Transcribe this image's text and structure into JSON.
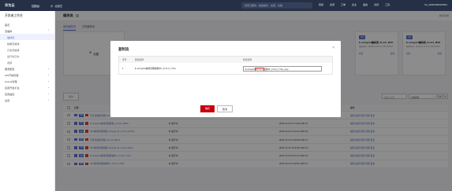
{
  "topbar": {
    "brand": "华为云",
    "console": "控制台",
    "region": "北京四",
    "search_placeholder": "搜索云服务、快捷操作、资源、文档",
    "links": [
      "费用",
      "资源",
      "工单",
      "企业",
      "备案",
      "支持",
      "工具"
    ],
    "user": "hw_00001000010001"
  },
  "sidebar": {
    "title": "开发者工作台",
    "items": [
      {
        "label": "首页",
        "active": false,
        "sub": false
      },
      {
        "label": "流编排",
        "active": false,
        "sub": false,
        "arrow": "⌃"
      },
      {
        "label": "编排流",
        "active": true,
        "sub": true
      },
      {
        "label": "数据流编排",
        "active": false,
        "sub": true
      },
      {
        "label": "日志流编排",
        "active": false,
        "sub": true
      },
      {
        "label": "运行时日志",
        "active": false,
        "sub": true
      },
      {
        "label": "连接",
        "active": false,
        "sub": true
      },
      {
        "label": "服务配置",
        "active": false,
        "sub": false,
        "arrow": "⌄"
      },
      {
        "label": "API开放管理",
        "active": false,
        "sub": false,
        "arrow": "⌄"
      },
      {
        "label": "Assets管理",
        "active": false,
        "sub": false,
        "arrow": "⌄"
      },
      {
        "label": "应用开发平台",
        "active": false,
        "sub": false,
        "arrow": "⌄"
      },
      {
        "label": "应用监控",
        "active": false,
        "sub": false,
        "arrow": "⌄"
      },
      {
        "label": "设置",
        "active": false,
        "sub": false,
        "arrow": "⌄"
      }
    ]
  },
  "page": {
    "title": "编排流",
    "help": "?",
    "right_link": "新手引导",
    "tabs": [
      {
        "label": "我的编排流",
        "active": true
      },
      {
        "label": "共享编排流",
        "active": false
      }
    ]
  },
  "cards": {
    "create_label": "创建",
    "flows": [
      {
        "tag": "API",
        "name": "E-octogrd4编排流_21-9-0_8F/D",
        "meta": "更新时间：2023-10-16 17:11:25 GMT+8",
        "op1": "启用",
        "op2": "复制"
      },
      {
        "tag": "API",
        "name": "E-octogrd4编排流_21-9-0_8F/D",
        "meta": "更新时间：2023-10-16 17:11:25 GMT+8",
        "op1": "启用",
        "op2": "复制"
      }
    ]
  },
  "toolbar": {
    "batch_label": "删除",
    "filter_placeholder": "请输入名称",
    "search_label": "名称搜索",
    "search_icon": "⌕",
    "settings_icon": "⚙",
    "refresh_icon": "↻"
  },
  "table": {
    "headers": [
      "名称",
      "状态",
      "描述",
      "创建时间",
      "操作"
    ],
    "rows": [
      {
        "name": "日志流编排流程-Octogrd_M_21-9-0_testX_3a6d4",
        "status": "运行中",
        "desc": "",
        "time": "2023-10-16 16:35:05 GMT+8",
        "ops": "编辑  启用/停用  复制  更多"
      },
      {
        "name": "E-octogrd4编排流程模板_21-9-0_9f5e6",
        "status": "运行中",
        "desc": "",
        "time": "2023-10-16 17:11:25 GMT+8",
        "ops": "编辑  启用/停用  复制  更多"
      },
      {
        "name": "OP5编排流程模板-Octogrd_M_21-9-0_9c76d",
        "status": "运行中",
        "desc": "",
        "time": "2023-10-16 17:12:01 GMT+8",
        "ops": "编辑  启用/停用  复制  更多"
      },
      {
        "name": "日志流编排流程_21-9-0_3f0cd",
        "status": "运行中",
        "desc": "",
        "time": "2023-10-15 11:06:08 GMT+8",
        "ops": "编辑  启用/停用  复制  更多"
      },
      {
        "name": "OP5编排流程模板-Octogrd_M_21-9-0_8ac2",
        "status": "运行中",
        "desc": "",
        "time": "2023-10-13 10:20:06 GMT+8",
        "ops": "编辑  启用/停用  复制  更多"
      },
      {
        "name": "E-octogrd4编排流程模板BP_21-9-0_77da",
        "status": "运行中",
        "desc": "",
        "time": "2023-10-12 16:07:13 GMT+8",
        "ops": "编辑  启用/停用  复制  更多"
      },
      {
        "name": "OP5编排流程模板BP_21-9-0_5d72",
        "status": "运行中",
        "desc": "",
        "time": "2023-10-11 11:18:01 GMT+8",
        "ops": "编辑  启用/停用  复制  更多"
      }
    ]
  },
  "modal": {
    "title": "复制流",
    "close": "×",
    "headers": [
      "序号",
      "源流名称",
      "新流名称"
    ],
    "row": {
      "index": "1",
      "source": "E-octogrd4编排流程模板BP_21-9-0_77da",
      "new_prefix": "E-octogrd4",
      "new_highlight": "编排流程",
      "new_suffix": "模板BP_21-9-0_77da_copy"
    },
    "confirm": "确定",
    "cancel": "取消"
  }
}
